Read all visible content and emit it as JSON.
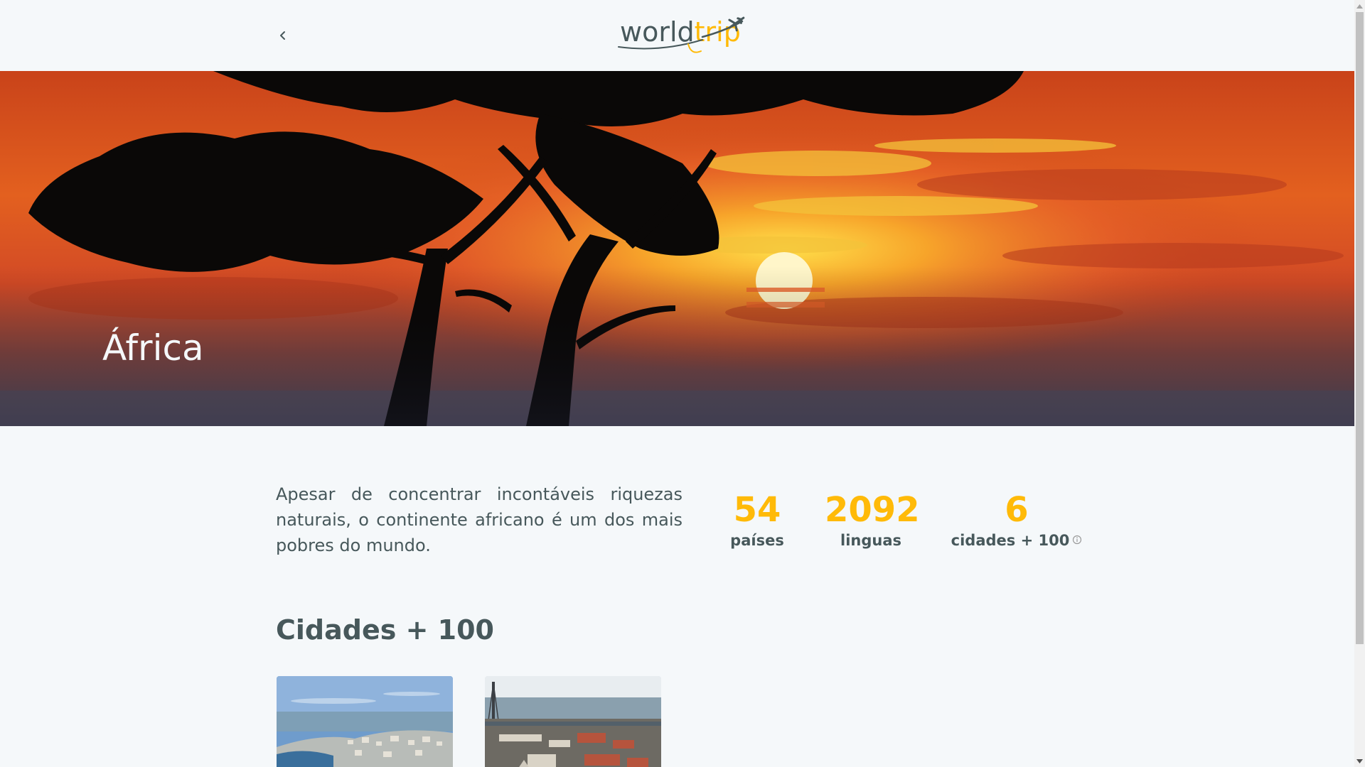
{
  "header": {
    "back_icon": "chevron-left-icon",
    "logo_part1": "world",
    "logo_part2": "trip",
    "logo_icon": "airplane-icon"
  },
  "hero": {
    "title": "África"
  },
  "continent": {
    "description": "Apesar de concentrar incontáveis riquezas naturais, o continente africano é um dos mais pobres do mundo.",
    "stats": [
      {
        "value": "54",
        "label": "países"
      },
      {
        "value": "2092",
        "label": "linguas"
      },
      {
        "value": "6",
        "label": "cidades + 100",
        "icon": "info-icon"
      }
    ]
  },
  "cities_section": {
    "title": "Cidades + 100"
  },
  "colors": {
    "accent": "#ffba08",
    "text": "#47585b",
    "background": "#f5f8fa"
  }
}
